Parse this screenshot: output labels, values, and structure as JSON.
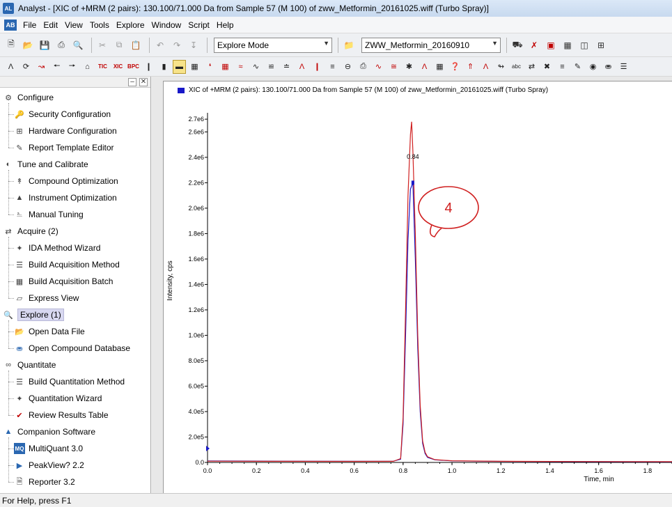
{
  "window": {
    "title": "Analyst - [XIC of +MRM (2 pairs): 130.100/71.000 Da  from Sample 57 (M 100) of zww_Metformin_20161025.wiff (Turbo Spray)]",
    "app_icon": "AL"
  },
  "menu": {
    "logo": "AB",
    "items": [
      "File",
      "Edit",
      "View",
      "Tools",
      "Explore",
      "Window",
      "Script",
      "Help"
    ]
  },
  "toolbar": {
    "mode_value": "Explore Mode",
    "project_value": "ZWW_Metformin_20160910"
  },
  "nav": {
    "items": [
      {
        "label": "Configure",
        "icon": "configure-icon",
        "level": 0
      },
      {
        "label": "Security Configuration",
        "icon": "key-icon",
        "level": 1
      },
      {
        "label": "Hardware Configuration",
        "icon": "hardware-grid-icon",
        "level": 1
      },
      {
        "label": "Report Template Editor",
        "icon": "pen-icon",
        "level": 1
      },
      {
        "label": "Tune and Calibrate",
        "icon": "tune-icon",
        "level": 0
      },
      {
        "label": "Compound Optimization",
        "icon": "compound-icon",
        "level": 1
      },
      {
        "label": "Instrument Optimization",
        "icon": "instrument-icon",
        "level": 1
      },
      {
        "label": "Manual Tuning",
        "icon": "manual-tuning-icon",
        "level": 1
      },
      {
        "label": "Acquire  (2)",
        "icon": "acquire-icon",
        "level": 0
      },
      {
        "label": "IDA Method Wizard",
        "icon": "wand-icon",
        "level": 1
      },
      {
        "label": "Build Acquisition Method",
        "icon": "method-icon",
        "level": 1
      },
      {
        "label": "Build Acquisition Batch",
        "icon": "batch-icon",
        "level": 1
      },
      {
        "label": "Express View",
        "icon": "express-icon",
        "level": 1
      },
      {
        "label": "Explore  (1)",
        "icon": "explore-icon",
        "level": 0,
        "selected": true
      },
      {
        "label": "Open Data File",
        "icon": "folder-open-icon",
        "level": 1
      },
      {
        "label": "Open Compound Database",
        "icon": "database-icon",
        "level": 1
      },
      {
        "label": "Quantitate",
        "icon": "quantitate-icon",
        "level": 0
      },
      {
        "label": "Build Quantitation Method",
        "icon": "quant-method-icon",
        "level": 1
      },
      {
        "label": "Quantitation Wizard",
        "icon": "wand-icon",
        "level": 1
      },
      {
        "label": "Review Results Table",
        "icon": "results-table-icon",
        "level": 1
      },
      {
        "label": "Companion Software",
        "icon": "companion-icon",
        "level": 0
      },
      {
        "label": "MultiQuant 3.0",
        "icon": "multiquant-icon",
        "level": 1
      },
      {
        "label": "PeakView? 2.2",
        "icon": "peakview-icon",
        "level": 1
      },
      {
        "label": "Reporter 3.2",
        "icon": "reporter-icon",
        "level": 1
      }
    ]
  },
  "plot": {
    "title": "XIC of +MRM (2 pairs): 130.100/71.000 Da  from Sample 57 (M 100) of zww_Metformin_20161025.wiff (Turbo Spray)",
    "series_color": "#1818c8",
    "annotation_color": "#d02020"
  },
  "chart_data": {
    "type": "line",
    "title": "XIC of +MRM (2 pairs): 130.100/71.000 Da  from Sample 57 (M 100) of zww_Metformin_20161025.wiff (Turbo Spray)",
    "xlabel": "Time, min",
    "ylabel": "Intensity, cps",
    "xlim": [
      0.0,
      1.9
    ],
    "ylim": [
      0,
      2750000.0
    ],
    "x_ticks": [
      "0.0",
      "0.2",
      "0.4",
      "0.6",
      "0.8",
      "1.0",
      "1.2",
      "1.4",
      "1.6",
      "1.8"
    ],
    "y_ticks": [
      "0.0",
      "2.0e5",
      "4.0e5",
      "6.0e5",
      "8.0e5",
      "1.0e6",
      "1.2e6",
      "1.4e6",
      "1.6e6",
      "1.8e6",
      "2.0e6",
      "2.2e6",
      "2.4e6",
      "2.6e6",
      "2.7e6"
    ],
    "y_tick_values": [
      0,
      200000,
      400000,
      600000,
      800000,
      1000000,
      1200000,
      1400000,
      1600000,
      1800000,
      2000000,
      2200000,
      2400000,
      2600000,
      2700000
    ],
    "series": [
      {
        "color": "#1818c8",
        "x": [
          0.0,
          0.3,
          0.6,
          0.76,
          0.79,
          0.8,
          0.81,
          0.82,
          0.83,
          0.84,
          0.85,
          0.86,
          0.87,
          0.88,
          0.89,
          0.9,
          0.93,
          1.0,
          1.2,
          1.5,
          1.9
        ],
        "y": [
          12000,
          10000,
          9000,
          10000,
          25000,
          300000,
          1000000,
          1750000,
          2150000,
          2200000,
          1600000,
          900000,
          400000,
          150000,
          70000,
          40000,
          20000,
          12000,
          8000,
          6000,
          5000
        ]
      },
      {
        "color": "#d02020",
        "x": [
          0.0,
          0.3,
          0.6,
          0.76,
          0.79,
          0.8,
          0.81,
          0.82,
          0.83,
          0.835,
          0.84,
          0.85,
          0.86,
          0.87,
          0.88,
          0.89,
          0.9,
          0.93,
          1.0,
          1.2,
          1.5,
          1.9
        ],
        "y": [
          10000,
          9000,
          8000,
          9000,
          30000,
          350000,
          1200000,
          2100000,
          2580000,
          2680000,
          2450000,
          1800000,
          1000000,
          450000,
          170000,
          80000,
          45000,
          22000,
          13000,
          9000,
          7000,
          6000
        ]
      }
    ],
    "annotations": [
      {
        "text": "0.84",
        "x": 0.84,
        "y": 2200000
      },
      {
        "text": "4",
        "shape": "speech-bubble"
      }
    ]
  },
  "status": {
    "text": "For Help, press F1"
  }
}
